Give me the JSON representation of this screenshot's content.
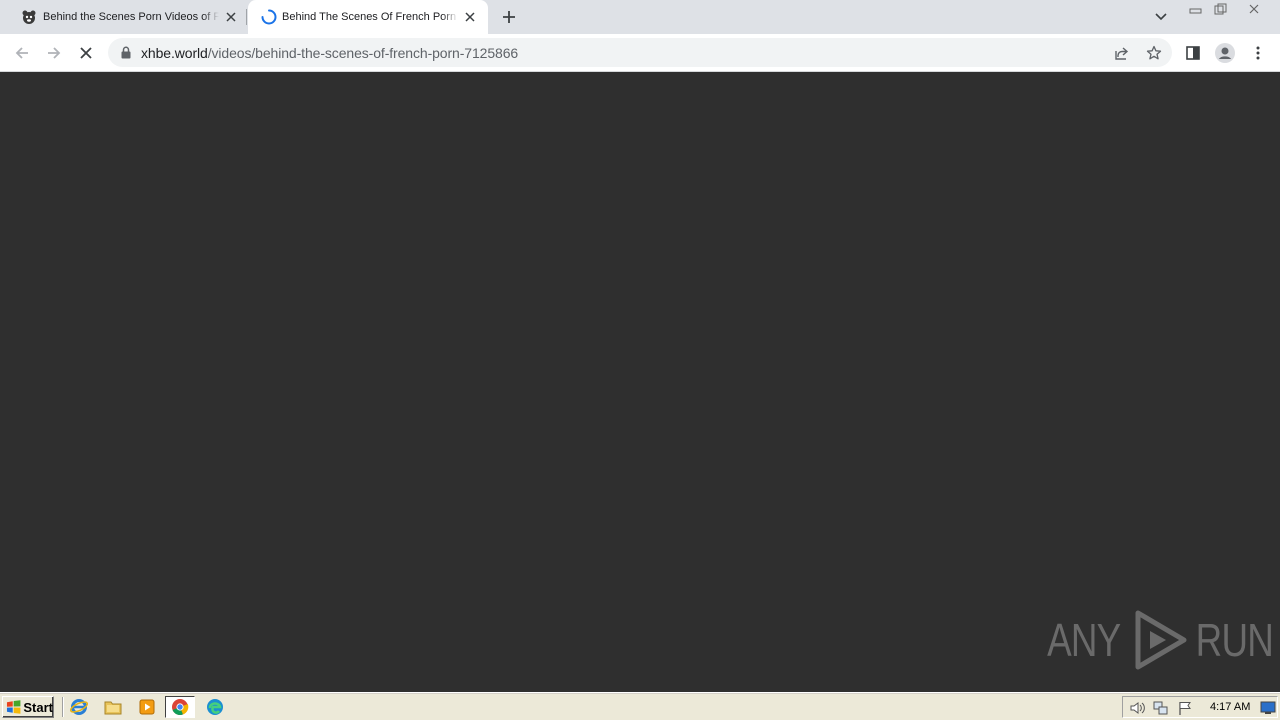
{
  "browser": {
    "tabs": [
      {
        "title": "Behind the Scenes Porn Videos of Fu",
        "favicon": "xhamster-icon",
        "active": false
      },
      {
        "title": "Behind The Scenes Of French Porn |",
        "favicon": "loading-spinner-icon",
        "active": true
      }
    ],
    "url": {
      "host": "xhbe.world",
      "path": "/videos/behind-the-scenes-of-french-porn-7125866"
    }
  },
  "content": {
    "background_color": "#2f2f2f",
    "watermark": {
      "left_text": "ANY",
      "right_text": "RUN"
    }
  },
  "taskbar": {
    "start_label": "Start",
    "quick_launch": [
      "internet-explorer-icon",
      "folder-icon",
      "media-player-icon",
      "chrome-icon",
      "edge-icon"
    ],
    "tray_icons": [
      "volume-icon",
      "network-icon",
      "flag-icon",
      "desktop-icon"
    ],
    "clock": "4:17 AM"
  },
  "colors": {
    "tabstrip": "#dee1e6",
    "toolbar": "#ffffff",
    "omnibox": "#f1f3f4",
    "spinner": "#1a73e8",
    "taskbar": "#ece9d8"
  }
}
